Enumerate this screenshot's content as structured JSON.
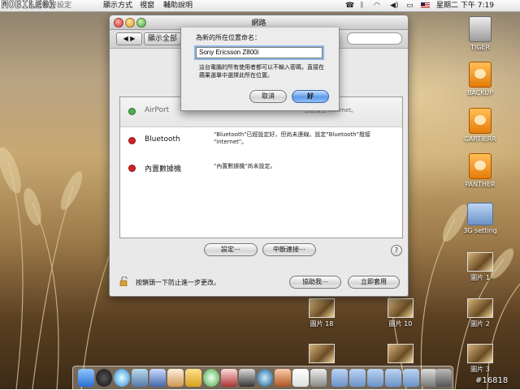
{
  "menubar": {
    "logo": "MOBILE01",
    "app_name": "系統偏好設定",
    "menus": [
      "顯示方式",
      "視窗",
      "輔助說明"
    ],
    "clock": "星期二 下午 7:19"
  },
  "window": {
    "title": "網路",
    "show_all": "顯示全部",
    "services": [
      {
        "name": "AirPort",
        "status_color": "#4caf50",
        "description": "已連接至 Internet。"
      },
      {
        "name": "Bluetooth",
        "status_color": "#d62020",
        "description": "\"Bluetooth\"已經設定好，但尚未連線。設定\"Bluetooth\"撥接 \"internet\"。"
      },
      {
        "name": "內置數據機",
        "status_color": "#d62020",
        "description": "\"內置數據機\"尚未設定。"
      }
    ],
    "configure_button": "設定⋯",
    "disconnect_button": "中斷連接⋯",
    "help_button": "?",
    "lock_text": "按鎖頭一下防止進一步更改。",
    "assist_button": "協助我⋯",
    "apply_button": "立即套用"
  },
  "sheet": {
    "label": "為新的所在位置命名：",
    "input_value": "Sony Ericsson Z800i",
    "note": "這台電腦的所有使用者都可以不輸入密碼，直接在蘋果選單中選擇此所在位置。",
    "cancel_button": "取消",
    "ok_button": "好"
  },
  "desktop_icons": [
    {
      "label": "TIGER"
    },
    {
      "label": "BACKUP"
    },
    {
      "label": "CARTIERR"
    },
    {
      "label": "PANTHER"
    },
    {
      "label": "3G setting"
    },
    {
      "label": "圖片 1"
    },
    {
      "label": "圖片 18"
    },
    {
      "label": "圖片 10"
    },
    {
      "label": "圖片 2"
    },
    {
      "label": "圖片 3"
    }
  ],
  "watermark": "#16818"
}
